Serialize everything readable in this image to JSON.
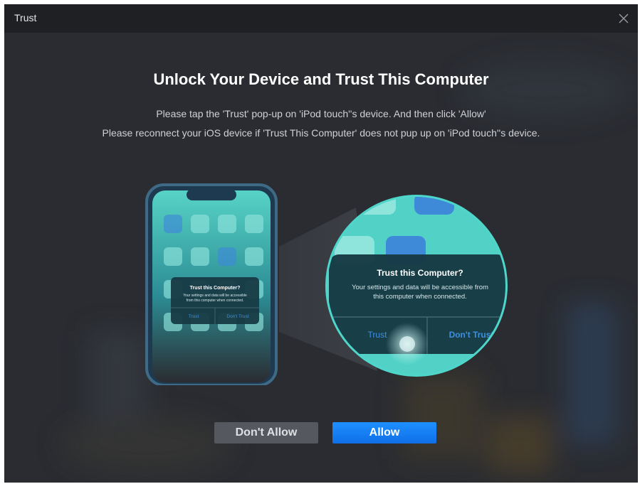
{
  "window": {
    "title": "Trust"
  },
  "heading": "Unlock Your Device and Trust This Computer",
  "instructions": {
    "line1": "Please tap the 'Trust' pop-up on 'iPod touch''s device. And then click 'Allow'",
    "line2": "Please reconnect your iOS device if 'Trust This Computer' does not pup up on 'iPod touch''s device."
  },
  "phone_popup": {
    "title": "Trust this Computer?",
    "body_line1": "Your settings and data will be accessible",
    "body_line2": "from this computer when connected.",
    "trust": "Trust",
    "dont_trust": "Don't Trust"
  },
  "zoom_popup": {
    "title": "Trust this Computer?",
    "body_line1": "Your settings and data will be accessible from",
    "body_line2": "this computer when connected.",
    "trust": "Trust",
    "dont_trust": "Don't Trust"
  },
  "buttons": {
    "deny": "Don't Allow",
    "allow": "Allow"
  },
  "colors": {
    "accent": "#1e90ff",
    "dialog_bg": "#2a2c31",
    "teal": "#4ec9c0"
  }
}
